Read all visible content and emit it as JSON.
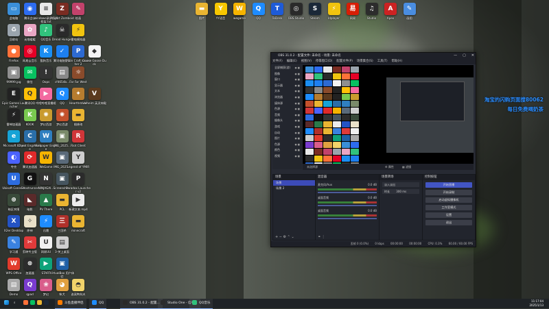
{
  "desktop_icons": [
    {
      "label": "此电脑",
      "icon": "computer-icon",
      "color": "#3b8fd9",
      "glyph": "▭",
      "pos": 0
    },
    {
      "label": "腾讯会议",
      "icon": "tencent-meeting-icon",
      "color": "#2d6cf0",
      "glyph": "◉",
      "pos": 1
    },
    {
      "label": "windows录屏剪辑框架.txt",
      "icon": "text-file-icon",
      "color": "#e8e8e8",
      "glyph": "≡",
      "pos": 2
    },
    {
      "label": "Project Zomboid",
      "icon": "zomboid-icon",
      "color": "#7a2c22",
      "glyph": "Z",
      "pos": 3
    },
    {
      "label": "绘画",
      "icon": "paint-icon",
      "color": "#c2426b",
      "glyph": "✎",
      "pos": 4
    },
    {
      "label": "回收站",
      "icon": "recycle-bin-icon",
      "color": "#9aa4ad",
      "glyph": "♻",
      "pos": 10
    },
    {
      "label": "无限暖暖",
      "icon": "infinity-nikki-icon",
      "color": "#e9a6c4",
      "glyph": "✿",
      "pos": 11
    },
    {
      "label": "QQ音乐",
      "icon": "qq-music-icon",
      "color": "#31c27c",
      "glyph": "♪",
      "pos": 12
    },
    {
      "label": "Dread Hunger",
      "icon": "dread-hunger-icon",
      "color": "#2a2a2a",
      "glyph": "☠",
      "pos": 13
    },
    {
      "label": "雷电模拟器",
      "icon": "ldplayer-icon",
      "color": "#f1c40f",
      "glyph": "⚡",
      "pos": 14
    },
    {
      "label": "Firefox",
      "icon": "firefox-icon",
      "color": "#ff7139",
      "glyph": "●",
      "pos": 20
    },
    {
      "label": "网易云音乐",
      "icon": "netease-music-icon",
      "color": "#e60026",
      "glyph": "◎",
      "pos": 21
    },
    {
      "label": "酷狗音乐",
      "icon": "kugou-icon",
      "color": "#1b8ef2",
      "glyph": "K",
      "pos": 22
    },
    {
      "label": "腾讯电脑管家",
      "icon": "pc-manager-icon",
      "color": "#1d7ff0",
      "glyph": "✓",
      "pos": 23
    },
    {
      "label": "Plain Craft Launcher 2",
      "icon": "pcl-icon",
      "color": "#2d6ad2",
      "glyph": "P",
      "pos": 24
    },
    {
      "label": "Goose Goose Duck",
      "icon": "goose-duck-icon",
      "color": "#f3f3f3",
      "glyph": "◆",
      "pos": 25
    },
    {
      "label": "99999.jpg",
      "icon": "image-file-icon",
      "color": "#8f8f8f",
      "glyph": "▣",
      "pos": 30
    },
    {
      "label": "微信",
      "icon": "wechat-icon",
      "color": "#07c160",
      "glyph": "✉",
      "pos": 31
    },
    {
      "label": "Oops",
      "icon": "oops-icon",
      "color": "#333",
      "glyph": "!",
      "pos": 32
    },
    {
      "label": "cf4654b...",
      "icon": "file-icon",
      "color": "#888",
      "glyph": "▤",
      "pos": 33
    },
    {
      "label": "Far Far West",
      "icon": "far-far-west-icon",
      "color": "#8a4b2b",
      "glyph": "☼",
      "pos": 34
    },
    {
      "label": "Epic Games Launcher",
      "icon": "epic-games-icon",
      "color": "#222",
      "glyph": "E",
      "pos": 40
    },
    {
      "label": "腾讯QQ",
      "icon": "qq-icon",
      "color": "#ffc107",
      "glyph": "Q",
      "pos": 41
    },
    {
      "label": "哔哩哔哩直播姬",
      "icon": "bilibili-live-icon",
      "color": "#f36aa0",
      "glyph": "▶",
      "pos": 42
    },
    {
      "label": "QQ",
      "icon": "qq-icon",
      "color": "#1e8cff",
      "glyph": "Q",
      "pos": 43
    },
    {
      "label": "Hearthstone",
      "icon": "hearthstone-icon",
      "color": "#b67c2f",
      "glyph": "✦",
      "pos": 44
    },
    {
      "label": "Valheim 英灵神殿",
      "icon": "valheim-icon",
      "color": "#5b3a1e",
      "glyph": "V",
      "pos": 45
    },
    {
      "label": "雷神加速器",
      "icon": "leishen-icon",
      "color": "#222",
      "glyph": "⚡",
      "pos": 50
    },
    {
      "label": "KOOK",
      "icon": "kook-icon",
      "color": "#79c94f",
      "glyph": "K",
      "pos": 51
    },
    {
      "label": "梦幻西游",
      "icon": "mhxy-icon",
      "color": "#c99b2f",
      "glyph": "✺",
      "pos": 52
    },
    {
      "label": "梦幻西游",
      "icon": "mhxy2-icon",
      "color": "#c4512c",
      "glyph": "✺",
      "pos": 53
    },
    {
      "label": "随便改",
      "icon": "folder-icon",
      "color": "#eab532",
      "glyph": "▬",
      "pos": 54
    },
    {
      "label": "Microsoft Edge",
      "icon": "edge-icon",
      "color": "#16a3d6",
      "glyph": "e",
      "pos": 60
    },
    {
      "label": "Cheat Engine.exe",
      "icon": "cheat-engine-icon",
      "color": "#2a6ea8",
      "glyph": "C",
      "pos": 61
    },
    {
      "label": "Wallpaper Engine",
      "icon": "wallpaper-engine-icon",
      "color": "#2f7fc0",
      "glyph": "W",
      "pos": 62
    },
    {
      "label": "IMG_2025...",
      "icon": "image-file-icon",
      "color": "#7a8a6a",
      "glyph": "▣",
      "pos": 63
    },
    {
      "label": "Riot Client",
      "icon": "riot-client-icon",
      "color": "#d13639",
      "glyph": "R",
      "pos": 64
    },
    {
      "label": "夸克",
      "icon": "quark-icon",
      "color": "#4a62ff",
      "glyph": "◐",
      "pos": 70
    },
    {
      "label": "腾讯加速器",
      "icon": "tencent-accel-icon",
      "color": "#e02a2a",
      "glyph": "⟳",
      "pos": 71
    },
    {
      "label": "WeGame",
      "icon": "wegame-icon",
      "color": "#f5b400",
      "glyph": "W",
      "pos": 72
    },
    {
      "label": "IMG_2025...",
      "icon": "image-file-icon",
      "color": "#5a6a7a",
      "glyph": "▣",
      "pos": 73
    },
    {
      "label": "Legend of YMIR",
      "icon": "ymir-icon",
      "color": "#cfcfcf",
      "glyph": "Y",
      "pos": 74
    },
    {
      "label": "Ubisoft Connect",
      "icon": "ubisoft-icon",
      "color": "#2d6cdf",
      "glyph": "U",
      "pos": 80
    },
    {
      "label": "Ghostrunner",
      "icon": "ghostrunner-icon",
      "color": "#111",
      "glyph": "G",
      "pos": 81
    },
    {
      "label": "NINJAGAI...",
      "icon": "ninja-icon",
      "color": "#333",
      "glyph": "N",
      "pos": 82
    },
    {
      "label": "Screensho...",
      "icon": "image-file-icon",
      "color": "#46555f",
      "glyph": "▣",
      "pos": 83
    },
    {
      "label": "Paradox Launcher v2",
      "icon": "paradox-icon",
      "color": "#2b2b2b",
      "glyph": "P",
      "pos": 84
    },
    {
      "label": "暗区突围",
      "icon": "arena-breakout-icon",
      "color": "#394a3a",
      "glyph": "⊕",
      "pos": 90
    },
    {
      "label": "暗影",
      "icon": "shadow-game-icon",
      "color": "#5a2a2a",
      "glyph": "◣",
      "pos": 91
    },
    {
      "label": "PV There",
      "icon": "pv-there-icon",
      "color": "#2a7a4a",
      "glyph": "▲",
      "pos": 92
    },
    {
      "label": "PCL",
      "icon": "folder-icon",
      "color": "#eab532",
      "glyph": "▬",
      "pos": 93
    },
    {
      "label": "新建文本.mp4",
      "icon": "video-file-icon",
      "color": "#ececec",
      "glyph": "▶",
      "pos": 94
    },
    {
      "label": "X2er Desktop",
      "icon": "x2er-icon",
      "color": "#2453c4",
      "glyph": "X",
      "pos": 100
    },
    {
      "label": "原神",
      "icon": "genshin-icon",
      "color": "#e8e0c8",
      "glyph": "✧",
      "pos": 101
    },
    {
      "label": "迅雷",
      "icon": "xunlei-icon",
      "color": "#1e8cff",
      "glyph": "⚡",
      "pos": 102
    },
    {
      "label": "三国杀",
      "icon": "sanguosha-icon",
      "color": "#b0302a",
      "glyph": "三",
      "pos": 103
    },
    {
      "label": "minecraft",
      "icon": "folder-icon",
      "color": "#eab532",
      "glyph": "▬",
      "pos": 104
    },
    {
      "label": "学习通",
      "icon": "xuexitong-icon",
      "color": "#3a82e0",
      "glyph": "✎",
      "pos": 110
    },
    {
      "label": "剪映专业版",
      "icon": "capcut-icon",
      "color": "#e03a3a",
      "glyph": "✂",
      "pos": 111
    },
    {
      "label": "网易UU",
      "icon": "uu-icon",
      "color": "#f0f0f0",
      "glyph": "U",
      "pos": 112
    },
    {
      "label": "3-关上桌面",
      "icon": "file-icon",
      "color": "#cfcfcf",
      "glyph": "▤",
      "pos": 113
    },
    {
      "label": "WPS Office",
      "icon": "wps-icon",
      "color": "#e23b2c",
      "glyph": "W",
      "pos": 120
    },
    {
      "label": "加速器",
      "icon": "accel-icon",
      "color": "#2c2c2c",
      "glyph": "⊗",
      "pos": 121
    },
    {
      "label": "START",
      "icon": "start-app-icon",
      "color": "#0ea37a",
      "glyph": "▶",
      "pos": 122
    },
    {
      "label": "VirtualBox 用户体验",
      "icon": "virtualbox-icon",
      "color": "#1f5fa6",
      "glyph": "▣",
      "pos": 123
    },
    {
      "label": "Demo",
      "icon": "file-icon",
      "color": "#aaa",
      "glyph": "▤",
      "pos": 130
    },
    {
      "label": "qpad",
      "icon": "qpad-icon",
      "color": "#7a3ccf",
      "glyph": "Q",
      "pos": 131
    },
    {
      "label": "梦幻",
      "icon": "game-icon",
      "color": "#d95d8b",
      "glyph": "❀",
      "pos": 132
    },
    {
      "label": "柴犬",
      "icon": "shiba-icon",
      "color": "#e0a040",
      "glyph": "◕",
      "pos": 133
    },
    {
      "label": "逃离鸭科夫",
      "icon": "duckov-icon",
      "color": "#f2d36a",
      "glyph": "◓",
      "pos": 134
    }
  ],
  "top_icons": [
    {
      "label": "图片",
      "icon": "folder-icon",
      "color": "#eab532",
      "glyph": "▬"
    },
    {
      "label": "YY语音",
      "icon": "yy-icon",
      "color": "#f7c700",
      "glyph": "Y"
    },
    {
      "label": "wegame",
      "icon": "wegame-icon",
      "color": "#f5b400",
      "glyph": "W"
    },
    {
      "label": "QQ",
      "icon": "qq-icon",
      "color": "#1e8cff",
      "glyph": "Q"
    },
    {
      "label": "ToDesk",
      "icon": "todesk-icon",
      "color": "#1e5bd8",
      "glyph": "T"
    },
    {
      "label": "OBS Studio",
      "icon": "obs-icon",
      "color": "#2a2a2a",
      "glyph": "◎"
    },
    {
      "label": "Steam",
      "icon": "steam-icon",
      "color": "#1b2838",
      "glyph": "S"
    },
    {
      "label": "ldplayer",
      "icon": "ldplayer-icon",
      "color": "#f1c40f",
      "glyph": "⚡"
    },
    {
      "label": "网易",
      "icon": "netease-icon",
      "color": "#d81e06",
      "glyph": "易"
    },
    {
      "label": "Studio",
      "icon": "studio-icon",
      "color": "#2c2c2c",
      "glyph": "♫"
    },
    {
      "label": "Apex",
      "icon": "apex-icon",
      "color": "#c22",
      "glyph": "A"
    },
    {
      "label": "画图",
      "icon": "paint-icon",
      "color": "#4a8de0",
      "glyph": "✎"
    }
  ],
  "overlay": {
    "line1": "淘宝的闪购页面搜80062",
    "line2": "每日免费喝奶茶"
  },
  "obs": {
    "title": "OBS 31.0.2 - 配置文件: 未命名 - 场景: 未命名",
    "menu": [
      "文件(F)",
      "编辑(E)",
      "视图(V)",
      "停靠窗口(D)",
      "配置文件(P)",
      "场景集合(S)",
      "工具(T)",
      "帮助(H)"
    ],
    "sources": [
      "全屏捕获(游)",
      "图像",
      "窗口",
      "显示器",
      "文本",
      "浏览器",
      "媒体源",
      "色源",
      "音频",
      "摄像头",
      "游戏",
      "自动",
      "图片",
      "色源",
      "颜色",
      "视频"
    ],
    "preview_label": "未选择源",
    "preview_props": "⚙ 属性",
    "preview_filters": "▦ 滤镜",
    "scenes_title": "场景",
    "scenes": [
      "场景",
      "场景 2"
    ],
    "mixer_title": "混音器",
    "mixer_channels": [
      {
        "name": "麦克风/Aux",
        "db": "0.0 dB"
      },
      {
        "name": "桌面音频",
        "db": "0.0 dB"
      },
      {
        "name": "桌面音频",
        "db": "0.0 dB"
      }
    ],
    "transitions_title": "场景转场",
    "transition_type": "淡入淡出",
    "duration_label": "时长",
    "duration_value": "300 ms",
    "controls_title": "控制按钮",
    "controls": [
      "开始直播",
      "开始录制",
      "启动虚拟摄像机",
      "工作室模式",
      "设置",
      "退出"
    ],
    "status": [
      "丢帧 0 (0.0%)",
      "0 kbps",
      "00:00:00",
      "00:00:00",
      "CPU: 0.3%",
      "60.00 / 60.00 FPS"
    ]
  },
  "taskbar": {
    "search_placeholder": "搜索",
    "apps": [
      "斗鱼直播伴侣",
      "QQ",
      "OBS 31.0.2 - 配置...",
      "Studio One - 信号...",
      "QQ音乐"
    ],
    "time": "11:17:04",
    "date": "2025/1/13"
  }
}
